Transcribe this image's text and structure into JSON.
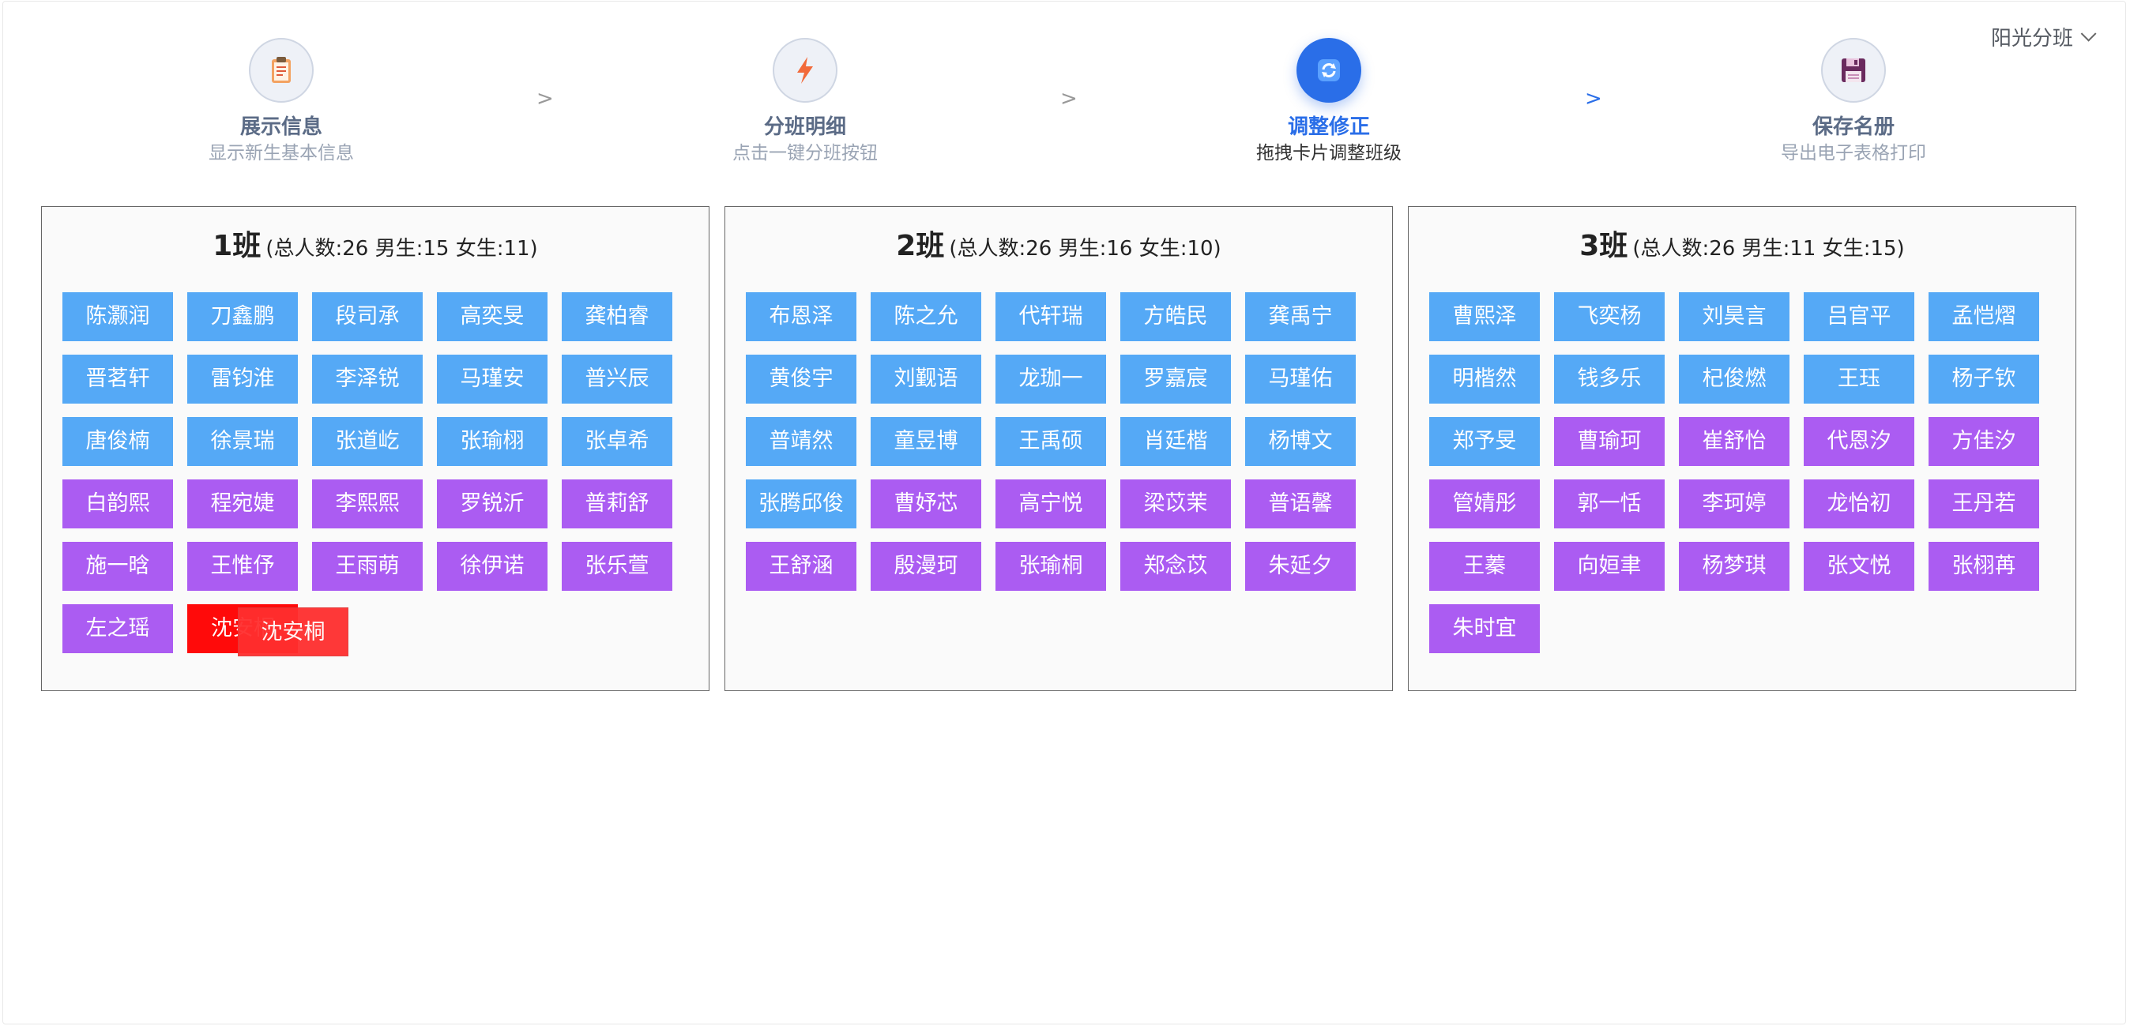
{
  "header": {
    "scheme_label": "阳光分班"
  },
  "steps": [
    {
      "title": "展示信息",
      "desc": "显示新生基本信息",
      "icon": "clipboard-icon",
      "state": "done"
    },
    {
      "title": "分班明细",
      "desc": "点击一键分班按钮",
      "icon": "lightning-icon",
      "state": "done"
    },
    {
      "title": "调整修正",
      "desc": "拖拽卡片调整班级",
      "icon": "refresh-icon",
      "state": "active"
    },
    {
      "title": "保存名册",
      "desc": "导出电子表格打印",
      "icon": "floppy-disk-icon",
      "state": "pending"
    }
  ],
  "step_separator": ">",
  "colors": {
    "boy_chip": "#55a9f6",
    "girl_chip": "#ab5cf2",
    "drag_chip": "#ff0a0a",
    "active_step": "#2a6ee8"
  },
  "classes": [
    {
      "name": "1班",
      "stats": "(总人数:26 男生:15 女生:11)",
      "students": [
        {
          "name": "陈灏润",
          "gender": "boy"
        },
        {
          "name": "刀鑫鹏",
          "gender": "boy"
        },
        {
          "name": "段司承",
          "gender": "boy"
        },
        {
          "name": "高奕旻",
          "gender": "boy"
        },
        {
          "name": "龚柏睿",
          "gender": "boy"
        },
        {
          "name": "晋茗轩",
          "gender": "boy"
        },
        {
          "name": "雷钧淮",
          "gender": "boy"
        },
        {
          "name": "李泽锐",
          "gender": "boy"
        },
        {
          "name": "马瑾安",
          "gender": "boy"
        },
        {
          "name": "普兴辰",
          "gender": "boy"
        },
        {
          "name": "唐俊楠",
          "gender": "boy"
        },
        {
          "name": "徐景瑞",
          "gender": "boy"
        },
        {
          "name": "张道屹",
          "gender": "boy"
        },
        {
          "name": "张瑜栩",
          "gender": "boy"
        },
        {
          "name": "张卓希",
          "gender": "boy"
        },
        {
          "name": "白韵熙",
          "gender": "girl"
        },
        {
          "name": "程宛婕",
          "gender": "girl"
        },
        {
          "name": "李熙熙",
          "gender": "girl"
        },
        {
          "name": "罗锐沂",
          "gender": "girl"
        },
        {
          "name": "普莉舒",
          "gender": "girl"
        },
        {
          "name": "施一晗",
          "gender": "girl"
        },
        {
          "name": "王惟伃",
          "gender": "girl"
        },
        {
          "name": "王雨萌",
          "gender": "girl"
        },
        {
          "name": "徐伊诺",
          "gender": "girl"
        },
        {
          "name": "张乐萱",
          "gender": "girl"
        },
        {
          "name": "左之瑶",
          "gender": "girl"
        },
        {
          "name": "沈安桐",
          "gender": "drag"
        }
      ],
      "drag_ghost": "沈安桐"
    },
    {
      "name": "2班",
      "stats": "(总人数:26 男生:16 女生:10)",
      "students": [
        {
          "name": "布恩泽",
          "gender": "boy"
        },
        {
          "name": "陈之允",
          "gender": "boy"
        },
        {
          "name": "代轩瑞",
          "gender": "boy"
        },
        {
          "name": "方皓民",
          "gender": "boy"
        },
        {
          "name": "龚禹宁",
          "gender": "boy"
        },
        {
          "name": "黄俊宇",
          "gender": "boy"
        },
        {
          "name": "刘觐语",
          "gender": "boy"
        },
        {
          "name": "龙珈一",
          "gender": "boy"
        },
        {
          "name": "罗嘉宸",
          "gender": "boy"
        },
        {
          "name": "马瑾佑",
          "gender": "boy"
        },
        {
          "name": "普靖然",
          "gender": "boy"
        },
        {
          "name": "童昱博",
          "gender": "boy"
        },
        {
          "name": "王禹硕",
          "gender": "boy"
        },
        {
          "name": "肖廷楷",
          "gender": "boy"
        },
        {
          "name": "杨博文",
          "gender": "boy"
        },
        {
          "name": "张腾邱俊",
          "gender": "boy"
        },
        {
          "name": "曹妤芯",
          "gender": "girl"
        },
        {
          "name": "高宁悦",
          "gender": "girl"
        },
        {
          "name": "梁苡茉",
          "gender": "girl"
        },
        {
          "name": "普语馨",
          "gender": "girl"
        },
        {
          "name": "王舒涵",
          "gender": "girl"
        },
        {
          "name": "殷漫珂",
          "gender": "girl"
        },
        {
          "name": "张瑜桐",
          "gender": "girl"
        },
        {
          "name": "郑念苡",
          "gender": "girl"
        },
        {
          "name": "朱延夕",
          "gender": "girl"
        }
      ]
    },
    {
      "name": "3班",
      "stats": "(总人数:26 男生:11 女生:15)",
      "students": [
        {
          "name": "曹熙泽",
          "gender": "boy"
        },
        {
          "name": "飞奕杨",
          "gender": "boy"
        },
        {
          "name": "刘昊言",
          "gender": "boy"
        },
        {
          "name": "吕官平",
          "gender": "boy"
        },
        {
          "name": "孟恺熠",
          "gender": "boy"
        },
        {
          "name": "明楷然",
          "gender": "boy"
        },
        {
          "name": "钱多乐",
          "gender": "boy"
        },
        {
          "name": "杞俊燃",
          "gender": "boy"
        },
        {
          "name": "王珏",
          "gender": "boy"
        },
        {
          "name": "杨子钦",
          "gender": "boy"
        },
        {
          "name": "郑予旻",
          "gender": "boy"
        },
        {
          "name": "曹瑜珂",
          "gender": "girl"
        },
        {
          "name": "崔舒怡",
          "gender": "girl"
        },
        {
          "name": "代恩汐",
          "gender": "girl"
        },
        {
          "name": "方佳汐",
          "gender": "girl"
        },
        {
          "name": "管婧彤",
          "gender": "girl"
        },
        {
          "name": "郭一恬",
          "gender": "girl"
        },
        {
          "name": "李珂婷",
          "gender": "girl"
        },
        {
          "name": "龙怡初",
          "gender": "girl"
        },
        {
          "name": "王丹若",
          "gender": "girl"
        },
        {
          "name": "王蓁",
          "gender": "girl"
        },
        {
          "name": "向姮聿",
          "gender": "girl"
        },
        {
          "name": "杨梦琪",
          "gender": "girl"
        },
        {
          "name": "张文悦",
          "gender": "girl"
        },
        {
          "name": "张栩苒",
          "gender": "girl"
        },
        {
          "name": "朱时宜",
          "gender": "girl"
        }
      ]
    }
  ]
}
